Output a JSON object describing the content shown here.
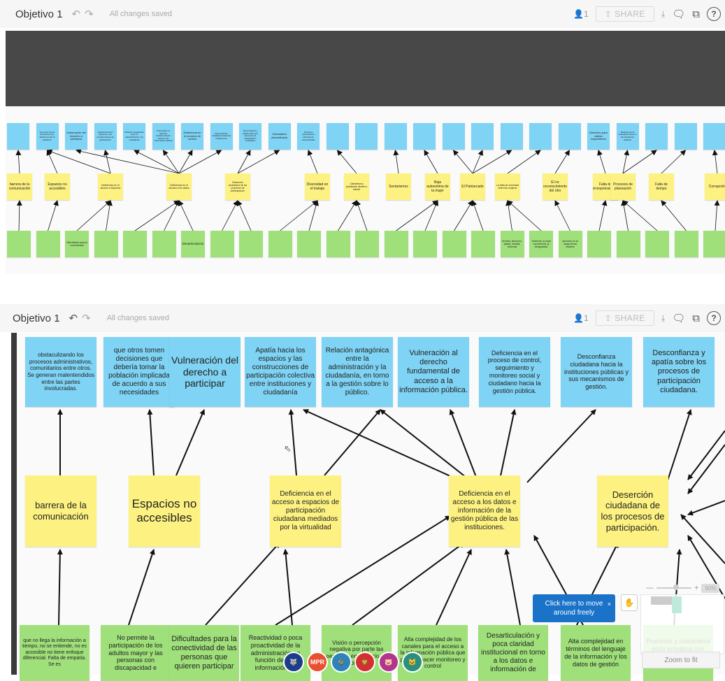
{
  "toolbar": {
    "title": "Objetivo 1",
    "saved": "All changes saved",
    "share": "SHARE",
    "users": "1"
  },
  "icons": {
    "undo": "undo-icon",
    "redo": "redo-icon",
    "user": "user-icon",
    "upload": "upload-icon",
    "download": "download-icon",
    "comment": "comment-icon",
    "search": "search-icon",
    "help": "help-icon",
    "hand": "hand-icon"
  },
  "top_board": {
    "blue": [
      "",
      "que otros tomen decisiones que debería tomar la población",
      "Vulneración del derecho a participar",
      "Apatía hacia los espacios y las construcciones de participación",
      "Relación antagónica entre la administración y la ciudadanía",
      "Vulneración al derecho fundamental de acceso a la información pública",
      "Deficiencia en el proceso de control",
      "Desconfianza ciudadana hacia las instituciones",
      "Desconfianza y apatía sobre los procesos de participación ciudadana",
      "Ciudadanía desmotivada",
      "Procesos participativos carentes de sostenibilidad",
      "",
      "",
      "",
      "",
      "",
      "",
      "",
      "",
      "",
      "Deterioro para validar seguimiento",
      "Rechazo de la ciudadanía frente a las decisiones públicas",
      "",
      "",
      ""
    ],
    "yellow": [
      "barrera de la comunicación",
      "Espacios no accesibles",
      "Deficiencia en el acceso a espacios",
      "Deficiencia en el acceso a los datos",
      "Deserción ciudadana de los procesos de participación",
      "Diversidad en el trabajo",
      "Clientelismo practicado desde lo barrial",
      "Sectarismos",
      "Baja autoestima de la mujer",
      "El Patriarcado",
      "La falta de sororidad entre las mujeres",
      "El no reconocimiento del otro",
      "Falta de corresponsabilidad",
      "Procesos de planeación",
      "Falta de tiempo",
      "Corrupción"
    ],
    "green": [
      "",
      "",
      "Dificultades para la conectividad",
      "",
      "",
      "",
      "Desarticulación",
      "",
      "",
      "",
      "",
      "",
      "",
      "",
      "",
      "",
      "",
      "Envidia, desunión, apatía, desidia, violencia",
      "Violencia, la mala convivencia, la desigualdad",
      "aumento en la carga de las mujeres",
      "",
      "",
      "",
      "",
      ""
    ]
  },
  "bottom_board": {
    "blue": [
      "obstaculizando los procesos administrativos, comunitarios entre otros. Se generan malentendidos entre las partes involucradas.",
      "que otros tomen decisiones que debería tomar la población implicada de acuerdo a sus necesidades",
      "Vulneración del derecho a participar",
      "Apatía hacia los espacios y las construcciones de participación colectiva entre instituciones y ciudadanía",
      "Relación antagónica entre la administración y la ciudadanía, en torno a la gestión sobre lo público.",
      "Vulneración al derecho fundamental de acceso a la información pública.",
      "Deficiencia en el proceso de control, seguimiento y monitoreo social y ciudadano hacia la gestión pública.",
      "Desconfianza ciudadana hacia la instituciones públicas y sus mecanismos de gestión.",
      "Desconfianza y apatía sobre los procesos de participación ciudadana."
    ],
    "yellow": [
      "barrera de la comunicación",
      "Espacios no accesibles",
      "Deficiencia en el acceso a espacios de participación ciudadana mediados por la virtualidad",
      "Deficiencia en el acceso a los datos e información de la gestión pública de las instituciones.",
      "Deserción ciudadana de los procesos de participación."
    ],
    "green": [
      "que no llega la información a tiempo, no se entiende, no es accesible no tiene enfoque diferencial. Falta de empatía. Se es",
      "No permite la participación de los adultos mayor y las personas con discapacidad e",
      "Dificultades para la conectividad de las personas que quieren participar",
      "Reactividad o poca proactividad de la administración en función de a la información de",
      "Visión o percepción negativa por parte las personas en ejercicio de control social y",
      "Alta complejidad de los canales para el acceso a la información pública que permite hacer monitoreo y control",
      "Desarticulación y poca claridad institucional en torno a los datos e información de",
      "Alta complejidad en términos del lenguaje de la información y los datos de gestión",
      "Procesos y ciudadanía poco empática con procesos de iniciación en los"
    ]
  },
  "tooltip": {
    "text": "Click here to move around freely",
    "close": "×"
  },
  "zoom": {
    "minus": "—",
    "plus": "+",
    "percent": "90%"
  },
  "zoom_button": "Zoom to fit",
  "avatars": [
    {
      "label": "🐺",
      "color": "#1d3d8a"
    },
    {
      "label": "MPR",
      "color": "#e8502f"
    },
    {
      "label": "🐐",
      "color": "#2c84b8"
    },
    {
      "label": "🦁",
      "color": "#d3302f"
    },
    {
      "label": "🐷",
      "color": "#b4358c"
    },
    {
      "label": "🐱",
      "color": "#2a8f7d"
    }
  ]
}
